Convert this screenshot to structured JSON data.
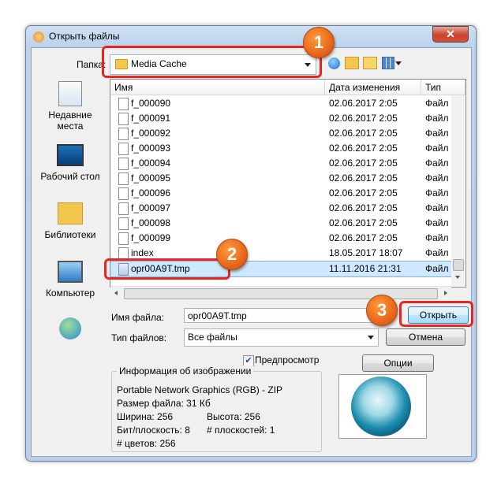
{
  "title": "Открыть файлы",
  "close_glyph": "✕",
  "folder": {
    "label": "Папка:",
    "value": "Media Cache"
  },
  "places": [
    {
      "label": "Недавние места",
      "icon": "recent-places-icon"
    },
    {
      "label": "Рабочий стол",
      "icon": "desktop-icon"
    },
    {
      "label": "Библиотеки",
      "icon": "libraries-icon"
    },
    {
      "label": "Компьютер",
      "icon": "computer-icon"
    },
    {
      "label": "",
      "icon": "network-icon"
    }
  ],
  "columns": {
    "name": "Имя",
    "date": "Дата изменения",
    "type": "Тип"
  },
  "files": [
    {
      "name": "f_000090",
      "date": "02.06.2017 2:05",
      "type": "Файл"
    },
    {
      "name": "f_000091",
      "date": "02.06.2017 2:05",
      "type": "Файл"
    },
    {
      "name": "f_000092",
      "date": "02.06.2017 2:05",
      "type": "Файл"
    },
    {
      "name": "f_000093",
      "date": "02.06.2017 2:05",
      "type": "Файл"
    },
    {
      "name": "f_000094",
      "date": "02.06.2017 2:05",
      "type": "Файл"
    },
    {
      "name": "f_000095",
      "date": "02.06.2017 2:05",
      "type": "Файл"
    },
    {
      "name": "f_000096",
      "date": "02.06.2017 2:05",
      "type": "Файл"
    },
    {
      "name": "f_000097",
      "date": "02.06.2017 2:05",
      "type": "Файл"
    },
    {
      "name": "f_000098",
      "date": "02.06.2017 2:05",
      "type": "Файл"
    },
    {
      "name": "f_000099",
      "date": "02.06.2017 2:05",
      "type": "Файл"
    },
    {
      "name": "index",
      "date": "18.05.2017 18:07",
      "type": "Файл"
    },
    {
      "name": "opr00A9T.tmp",
      "date": "11.11.2016 21:31",
      "type": "Файл"
    }
  ],
  "filename": {
    "label": "Имя файла:",
    "value": "opr00A9T.tmp"
  },
  "filetype": {
    "label": "Тип файлов:",
    "value": "Все файлы"
  },
  "buttons": {
    "open": "Открыть",
    "cancel": "Отмена",
    "options": "Опции"
  },
  "preview_label": "Предпросмотр",
  "info": {
    "title": "Информация об изображении",
    "format": "Portable Network Graphics (RGB) - ZIP",
    "size": "Размер файла: 31 Кб",
    "width": "Ширина: 256",
    "height": "Высота: 256",
    "bpp": "Бит/плоскость: 8",
    "planes": "# плоскостей: 1",
    "colors": "# цветов: 256"
  },
  "callouts": [
    "1",
    "2",
    "3"
  ],
  "colors": {
    "accent_red": "#e8261f",
    "callout_orange": "#e8671a",
    "selection": "#cde8ff"
  }
}
